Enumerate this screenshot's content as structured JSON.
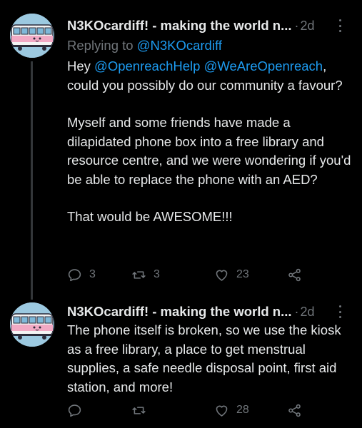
{
  "tweets": [
    {
      "author": "N3KOcardiff! - making the world n...",
      "dot": "·",
      "time": "2d",
      "replying_prefix": "Replying to",
      "replying_handle": "@N3KOcardiff",
      "para1_lead": "Hey",
      "mention1": "@OpenreachHelp",
      "mention2": "@WeAreOpenreach",
      "para1_tail": ", could you possibly do our community a favour?",
      "para2": "Myself and some friends have made a dilapidated phone box into a free library and resource centre, and we were wondering if you'd be able to replace the phone with an AED?",
      "para3": "That would be AWESOME!!!",
      "replies": "3",
      "retweets": "3",
      "likes": "23"
    },
    {
      "author": "N3KOcardiff! - making the world n...",
      "dot": "·",
      "time": "2d",
      "text": "The phone itself is broken, so we use the kiosk as a free library, a place to get menstrual supplies, a safe needle disposal point, first aid station, and more!",
      "replies": "",
      "retweets": "",
      "likes": "28"
    }
  ],
  "icons": {
    "reply": "reply-icon",
    "retweet": "retweet-icon",
    "like": "heart-icon",
    "share": "share-icon",
    "more": "more-icon"
  },
  "colors": {
    "background": "#000000",
    "text": "#e7e9ea",
    "muted": "#71767b",
    "link": "#1d9bf0"
  }
}
